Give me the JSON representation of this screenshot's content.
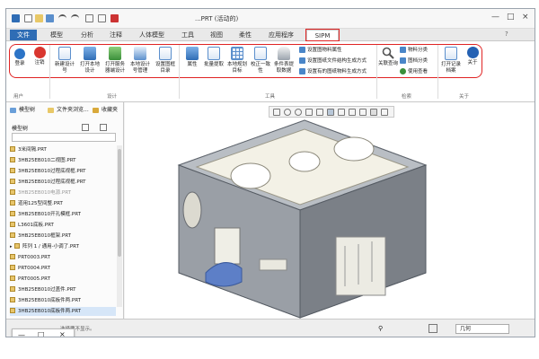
{
  "window": {
    "title": "...PRT (活动的)",
    "controls": [
      "—",
      "□",
      "×"
    ]
  },
  "tabs": [
    {
      "label": "文件"
    },
    {
      "label": "模型"
    },
    {
      "label": "分析"
    },
    {
      "label": "注释"
    },
    {
      "label": "人体模型"
    },
    {
      "label": "工具"
    },
    {
      "label": "视图"
    },
    {
      "label": "柔性"
    },
    {
      "label": "应用程序"
    },
    {
      "label": "SIPM"
    }
  ],
  "ribbon": {
    "buttons": [
      {
        "label": "登录",
        "icon": "user-icon"
      },
      {
        "label": "注销",
        "icon": "logout-icon"
      },
      {
        "label": "新建设计\n号",
        "icon": "new-doc-icon"
      },
      {
        "label": "打开本地\n设计",
        "icon": "open-folder-icon"
      },
      {
        "label": "打开服务\n器端设计",
        "icon": "server-icon"
      },
      {
        "label": "本地设计\n号管理",
        "icon": "manage-icon"
      },
      {
        "label": "设置图框\n目录",
        "icon": "frame-icon"
      },
      {
        "label": "属性",
        "icon": "properties-icon"
      },
      {
        "label": "批量提取",
        "icon": "batch-icon"
      },
      {
        "label": "本地规划\n目标",
        "icon": "grid-icon"
      },
      {
        "label": "校正一致\n性",
        "icon": "check-icon"
      },
      {
        "label": "条件表提\n取数据",
        "icon": "database-icon"
      },
      {
        "label": "关联查询",
        "icon": "search-icon"
      },
      {
        "label": "打开记录\n档案",
        "icon": "record-icon"
      },
      {
        "label": "关于",
        "icon": "info-icon"
      }
    ],
    "small_items": [
      {
        "label": "设置图物料属性"
      },
      {
        "label": "设置图纸文件结构生成方式"
      },
      {
        "label": "设置有的图纸物料生成方式"
      },
      {
        "label": "物料分类"
      },
      {
        "label": "图档分类"
      },
      {
        "label": "使用查看"
      }
    ],
    "groups": [
      "用户",
      "设计",
      "工具",
      "检索",
      "关于"
    ]
  },
  "left_panel": {
    "tabs": [
      "模型树",
      "文件夹浏览...",
      "收藏夹"
    ],
    "filter_label": "模型树",
    "items": [
      "3米间隔.PRT",
      "3HB25EB010二视图.PRT",
      "3HB25EB010过程底视框.PRT",
      "3HB25EB010过程底视框.PRT",
      "3HB25EB010电源.PRT",
      "道用125型间整.PRT",
      "3HB25EB010开孔模框.PRT",
      "L3601底板.PRT",
      "3HB25EB010框架.PRT",
      "阵列 1 / 通用-小调了.PRT",
      "PRT0003.PRT",
      "PRT0004.PRT",
      "PRT0005.PRT",
      "3HB25EB010过盖件.PRT",
      "3HB25EB010底板件两.PRT",
      "3HB25EB010底板件两.PRT"
    ]
  },
  "status": {
    "message": "选择要不显示。",
    "filter_value": "几何"
  }
}
